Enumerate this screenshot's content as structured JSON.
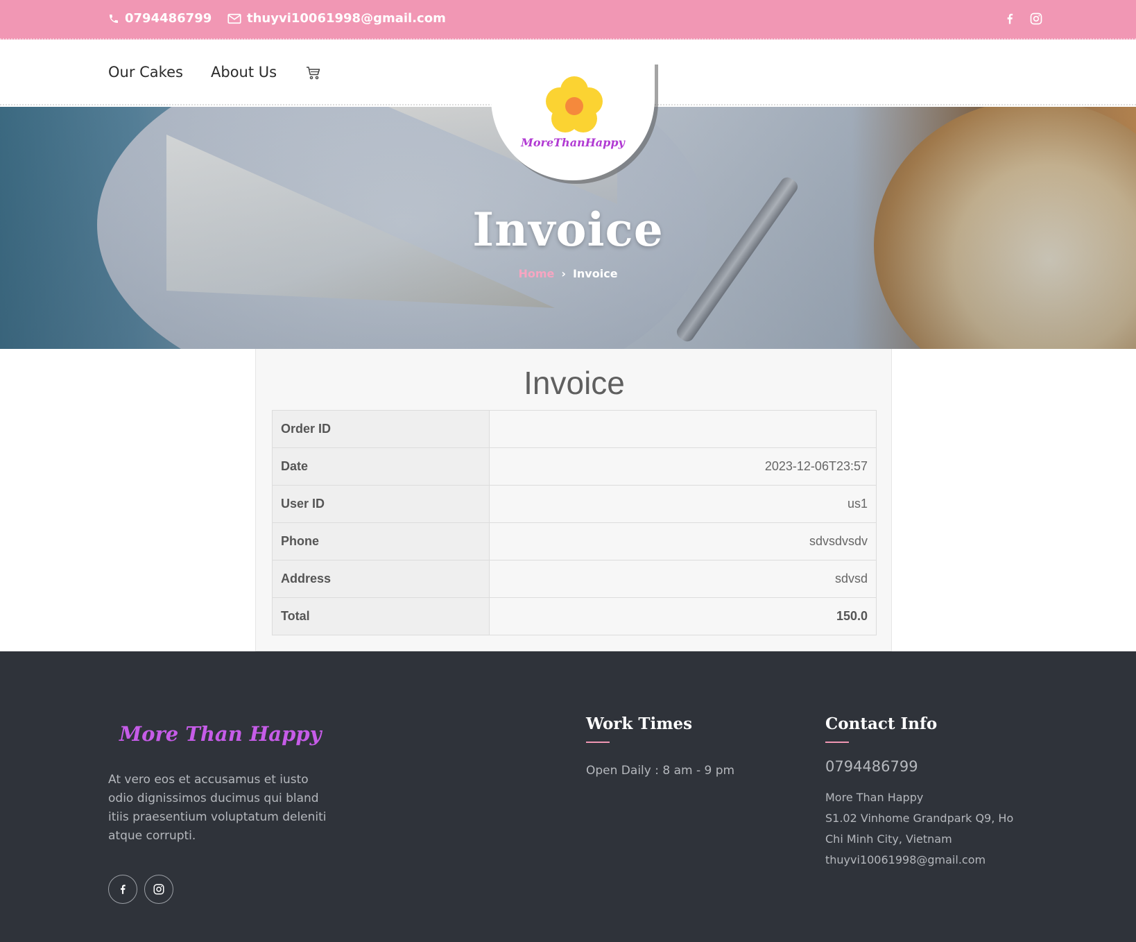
{
  "topbar": {
    "phone": "0794486799",
    "email": "thuyvi10061998@gmail.com",
    "social_icons": [
      "facebook-icon",
      "instagram-icon"
    ]
  },
  "nav": {
    "items": [
      {
        "label": "Our Cakes"
      },
      {
        "label": "About Us"
      }
    ],
    "cart_icon": "cart-icon"
  },
  "logo": {
    "text": "MoreThanHappy",
    "icon": "flower-icon"
  },
  "hero": {
    "title": "Invoice",
    "breadcrumb": {
      "home": "Home",
      "separator": "›",
      "current": "Invoice"
    }
  },
  "invoice": {
    "title": "Invoice",
    "rows": [
      {
        "label": "Order ID",
        "value": ""
      },
      {
        "label": "Date",
        "value": "2023-12-06T23:57"
      },
      {
        "label": "User ID",
        "value": "us1"
      },
      {
        "label": "Phone",
        "value": "sdvsdvsdv"
      },
      {
        "label": "Address",
        "value": "sdvsd"
      },
      {
        "label": "Total",
        "value": "150.0"
      }
    ]
  },
  "footer": {
    "logo_text": "More Than Happy",
    "about": "At vero eos et accusamus et iusto odio dignissimos ducimus qui bland itiis praesentium voluptatum deleniti atque corrupti.",
    "social_icons": [
      "facebook-icon",
      "instagram-icon"
    ],
    "work_times": {
      "heading": "Work Times",
      "hours": "Open Daily : 8 am - 9 pm"
    },
    "contact": {
      "heading": "Contact Info",
      "phone": "0794486799",
      "name": "More Than Happy",
      "address": "S1.02 Vinhome Grandpark Q9, Ho Chi Minh City, Vietnam",
      "email": "thuyvi10061998@gmail.com"
    }
  },
  "colors": {
    "topbar": "#f197b4",
    "footer": "#2f333a",
    "logo_purple": "#b13ad3",
    "accent_pink": "#f197b4"
  }
}
